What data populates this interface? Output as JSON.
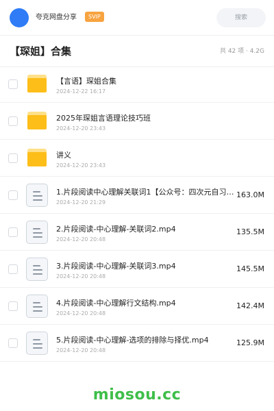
{
  "header": {
    "username": "夸克网盘分享",
    "badge": "SVIP",
    "search_placeholder": "搜索",
    "avatar_color": "#2f7cf6"
  },
  "page": {
    "title": "【琛姐】合集",
    "summary": "共 42 项 · 4.2G"
  },
  "files": [
    {
      "type": "folder",
      "icon": "folder-icon",
      "name": "【言语】琛姐合集",
      "date": "2024-12-22 16:17",
      "size": ""
    },
    {
      "type": "folder",
      "icon": "folder-icon",
      "name": "2025年琛姐言语理论技巧班",
      "date": "2024-12-20 23:43",
      "size": ""
    },
    {
      "type": "folder",
      "icon": "folder-icon",
      "name": "讲义",
      "date": "2024-12-20 23:43",
      "size": ""
    },
    {
      "type": "file",
      "icon": "video-file-icon",
      "name": "1.片段阅读中心理解关联词1【公众号：四次元自习室…",
      "date": "2024-12-20 21:29",
      "size": "163.0M"
    },
    {
      "type": "file",
      "icon": "video-file-icon",
      "name": "2.片段阅读-中心理解-关联词2.mp4",
      "date": "2024-12-20 20:48",
      "size": "135.5M"
    },
    {
      "type": "file",
      "icon": "video-file-icon",
      "name": "3.片段阅读-中心理解-关联词3.mp4",
      "date": "2024-12-20 20:48",
      "size": "145.5M"
    },
    {
      "type": "file",
      "icon": "video-file-icon",
      "name": "4.片段阅读-中心理解行文结构.mp4",
      "date": "2024-12-20 20:48",
      "size": "142.4M"
    },
    {
      "type": "file",
      "icon": "video-file-icon",
      "name": "5.片段阅读-中心理解-选项的排除与择优.mp4",
      "date": "2024-12-20 20:48",
      "size": "125.9M"
    }
  ],
  "watermark": "miosou.cc",
  "colors": {
    "accent": "#2f7cf6",
    "badge": "#f7a340",
    "folder": "#fdbe1a",
    "watermark": "#3fbe4a"
  }
}
